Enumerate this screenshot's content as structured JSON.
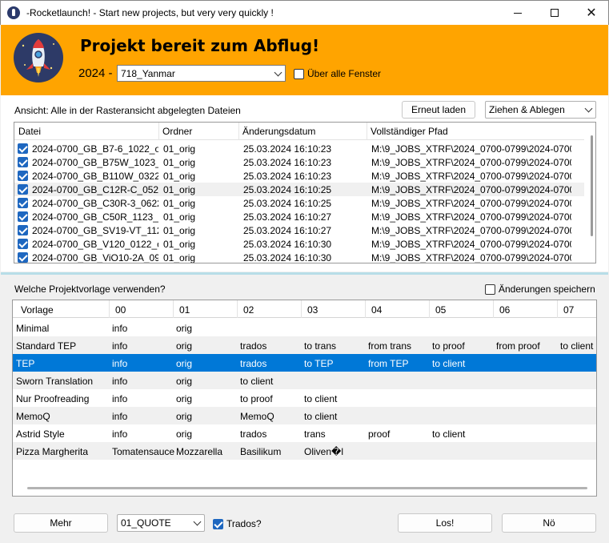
{
  "window": {
    "title": "-Rocketlaunch! - Start new projects, but very very quickly !"
  },
  "header": {
    "title": "Projekt bereit zum Abflug!",
    "year_label": "2024 -",
    "project_value": "718_Yanmar",
    "all_windows_label": "Über alle Fenster"
  },
  "files": {
    "caption": "Ansicht: Alle in der Rasteransicht abgelegten Dateien",
    "reload_label": "Erneut laden",
    "mode_value": "Ziehen & Ablegen",
    "columns": [
      "Datei",
      "Ordner",
      "Änderungsdatum",
      "Vollständiger Pfad"
    ],
    "rows": [
      {
        "file": "2024-0700_GB_B7-6_1022_ori...",
        "folder": "01_orig",
        "date": "25.03.2024 16:10:23",
        "path": "M:\\9_JOBS_XTRF\\2024_0700-0799\\2024-0700_..."
      },
      {
        "file": "2024-0700_GB_B75W_1023_...",
        "folder": "01_orig",
        "date": "25.03.2024 16:10:23",
        "path": "M:\\9_JOBS_XTRF\\2024_0700-0799\\2024-0700_..."
      },
      {
        "file": "2024-0700_GB_B110W_0322...",
        "folder": "01_orig",
        "date": "25.03.2024 16:10:23",
        "path": "M:\\9_JOBS_XTRF\\2024_0700-0799\\2024-0700_..."
      },
      {
        "file": "2024-0700_GB_C12R-C_0522...",
        "folder": "01_orig",
        "date": "25.03.2024 16:10:25",
        "path": "M:\\9_JOBS_XTRF\\2024_0700-0799\\2024-0700_..."
      },
      {
        "file": "2024-0700_GB_C30R-3_0622...",
        "folder": "01_orig",
        "date": "25.03.2024 16:10:25",
        "path": "M:\\9_JOBS_XTRF\\2024_0700-0799\\2024-0700_..."
      },
      {
        "file": "2024-0700_GB_C50R_1123_o...",
        "folder": "01_orig",
        "date": "25.03.2024 16:10:27",
        "path": "M:\\9_JOBS_XTRF\\2024_0700-0799\\2024-0700_..."
      },
      {
        "file": "2024-0700_GB_SV19-VT_112...",
        "folder": "01_orig",
        "date": "25.03.2024 16:10:27",
        "path": "M:\\9_JOBS_XTRF\\2024_0700-0799\\2024-0700_..."
      },
      {
        "file": "2024-0700_GB_V120_0122_o...",
        "folder": "01_orig",
        "date": "25.03.2024 16:10:30",
        "path": "M:\\9_JOBS_XTRF\\2024_0700-0799\\2024-0700_..."
      },
      {
        "file": "2024-0700_GB_ViO10-2A_092...",
        "folder": "01_orig",
        "date": "25.03.2024 16:10:30",
        "path": "M:\\9_JOBS_XTRF\\2024_0700-0799\\2024-0700_..."
      }
    ]
  },
  "templates": {
    "caption": "Welche Projektvorlage verwenden?",
    "save_changes_label": "Änderungen speichern",
    "columns": [
      "Vorlage",
      "00",
      "01",
      "02",
      "03",
      "04",
      "05",
      "06",
      "07"
    ],
    "rows": [
      [
        "Minimal",
        "info",
        "orig",
        "",
        "",
        "",
        "",
        "",
        ""
      ],
      [
        "Standard TEP",
        "info",
        "orig",
        "trados",
        "to trans",
        "from trans",
        "to proof",
        "from proof",
        "to client"
      ],
      [
        "TEP",
        "info",
        "orig",
        "trados",
        "to TEP",
        "from TEP",
        "to client",
        "",
        ""
      ],
      [
        "Sworn Translation",
        "info",
        "orig",
        "to client",
        "",
        "",
        "",
        "",
        ""
      ],
      [
        "Nur Proofreading",
        "info",
        "orig",
        "to proof",
        "to client",
        "",
        "",
        "",
        ""
      ],
      [
        "MemoQ",
        "info",
        "orig",
        "MemoQ",
        "to client",
        "",
        "",
        "",
        ""
      ],
      [
        "Astrid Style",
        "info",
        "orig",
        "trados",
        "trans",
        "proof",
        "to client",
        "",
        ""
      ],
      [
        "Pizza Margherita",
        "Tomatensauce",
        "Mozzarella",
        "Basilikum",
        "Oliven�l",
        "",
        "",
        "",
        ""
      ]
    ],
    "selected_index": 2
  },
  "footer": {
    "more_label": "Mehr",
    "quote_value": "01_QUOTE",
    "trados_label": "Trados?",
    "go_label": "Los!",
    "no_label": "Nö"
  },
  "colors": {
    "header_bg": "#ffa400",
    "selection": "#0078d7",
    "divider": "#b7dde8"
  }
}
